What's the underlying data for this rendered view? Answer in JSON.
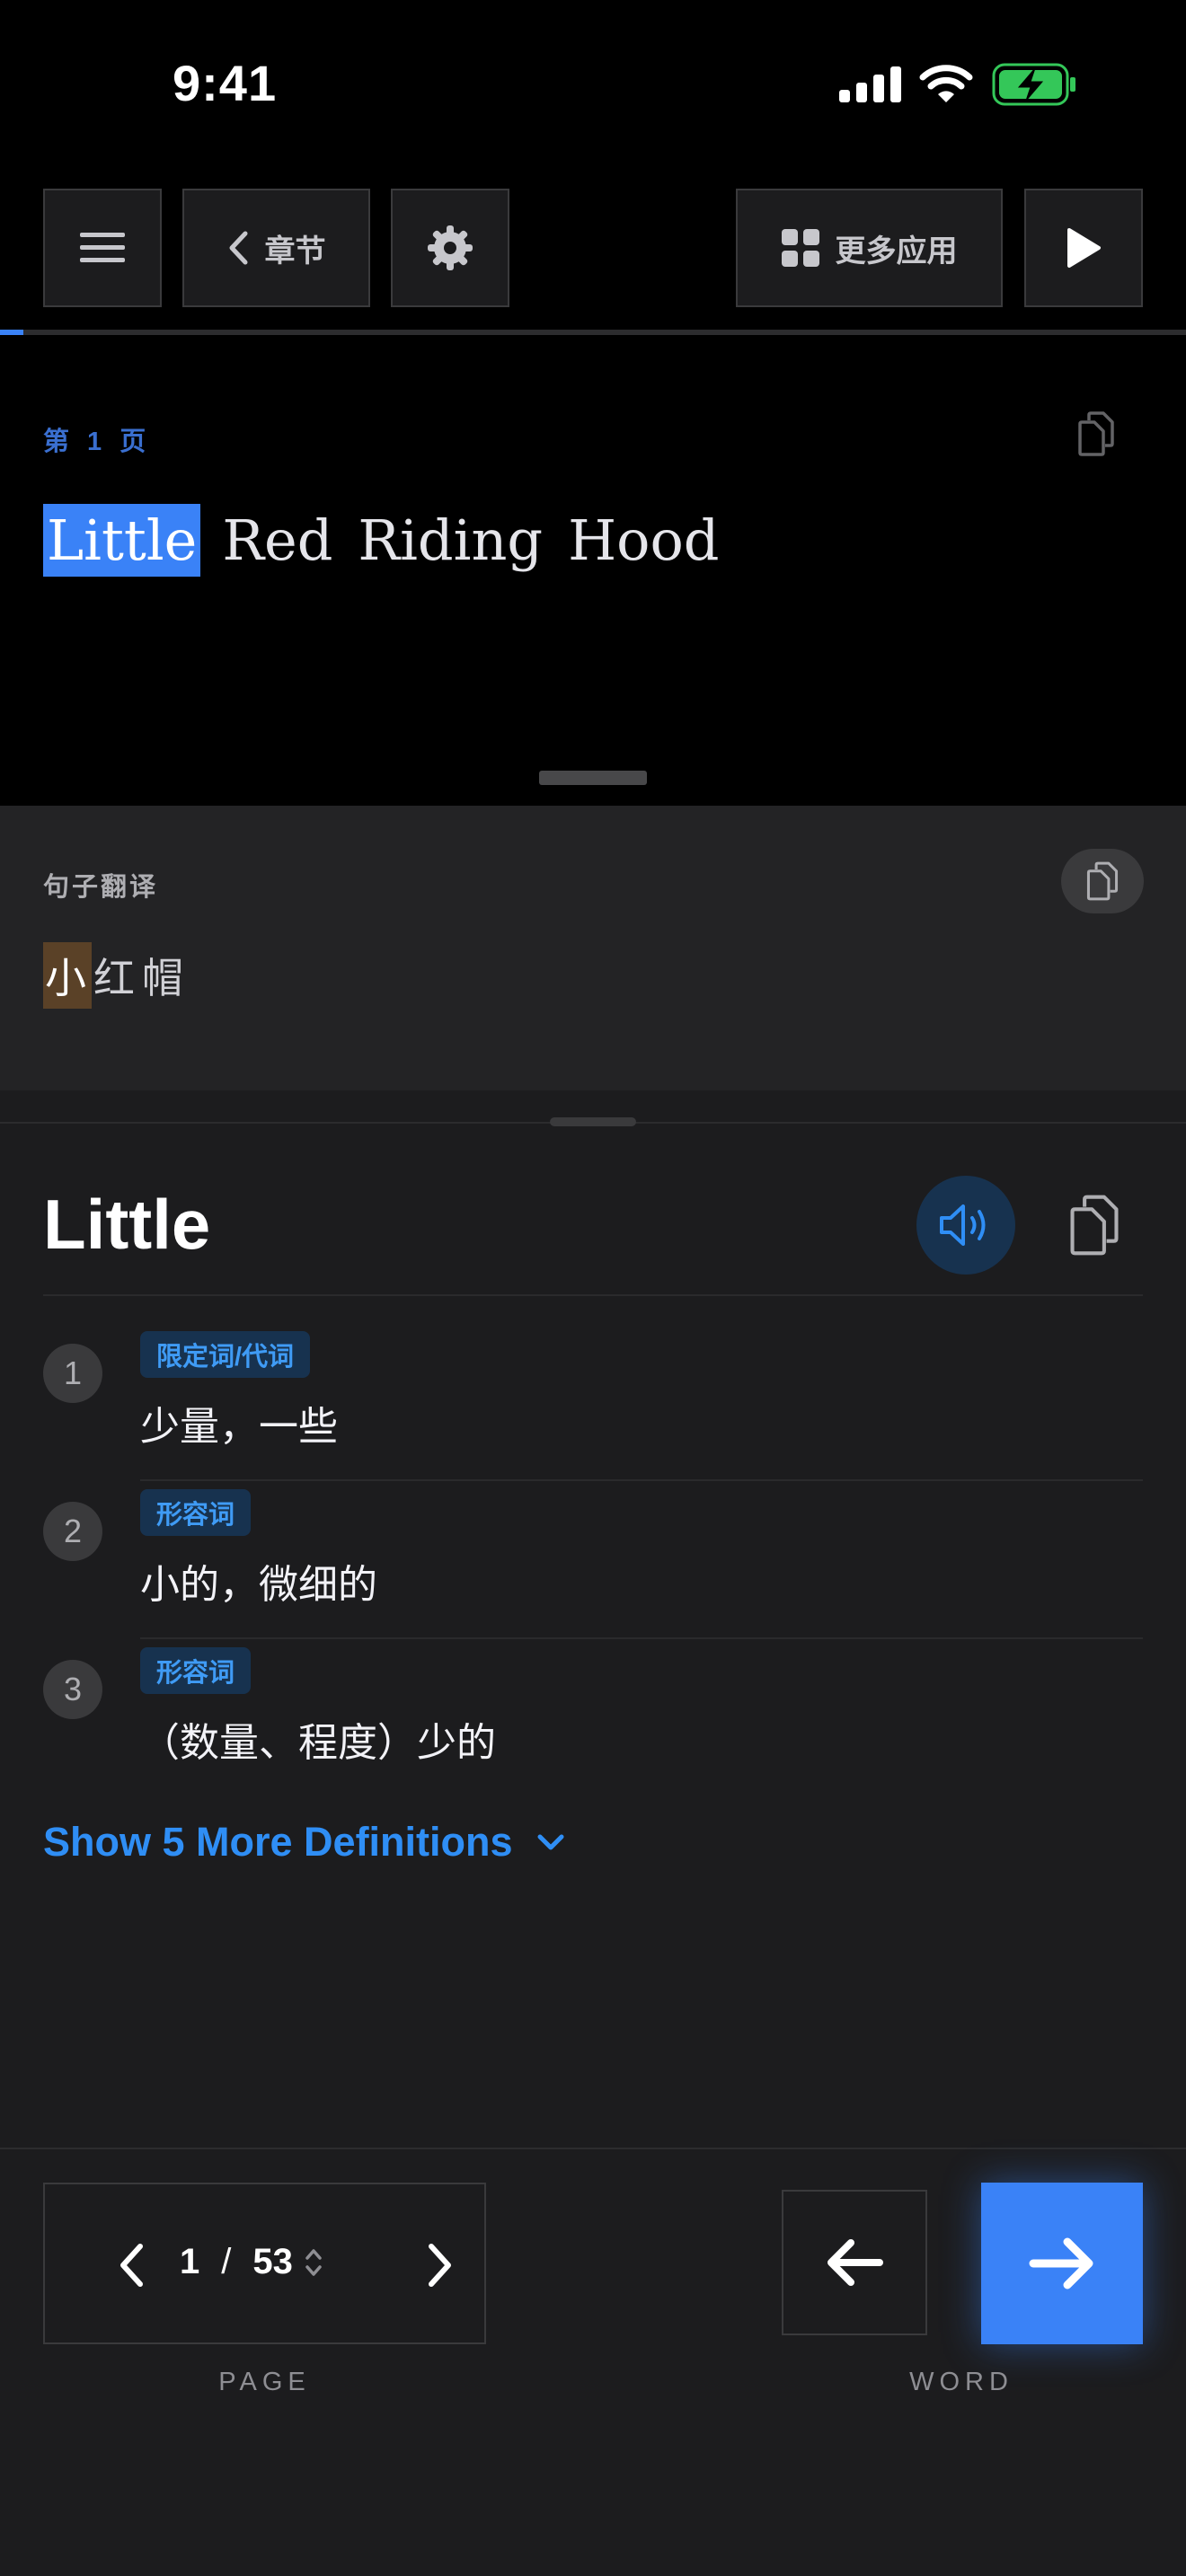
{
  "status_bar": {
    "time": "9:41"
  },
  "toolbar": {
    "chapters_label": "章节",
    "more_apps_label": "更多应用"
  },
  "reader": {
    "page_label": "第 1 页",
    "progress": 0.02,
    "sentence": [
      {
        "text": "Little",
        "highlighted": true
      },
      {
        "text": "Red",
        "highlighted": false
      },
      {
        "text": "Riding",
        "highlighted": false
      },
      {
        "text": "Hood",
        "highlighted": false
      }
    ]
  },
  "translation": {
    "title": "句子翻译",
    "chars": [
      "小",
      "红",
      "帽"
    ]
  },
  "dictionary": {
    "word": "Little",
    "definitions": [
      {
        "num": "1",
        "pos": "限定词/代词",
        "text": "少量，一些"
      },
      {
        "num": "2",
        "pos": "形容词",
        "text": "小的，微细的"
      },
      {
        "num": "3",
        "pos": "形容词",
        "text": "（数量、程度）少的"
      }
    ],
    "more_label": "Show 5 More Definitions"
  },
  "pager": {
    "current": "1",
    "separator": "/",
    "total": "53",
    "page_label": "PAGE",
    "word_label": "WORD"
  },
  "colors": {
    "accent": "#3a82f7",
    "link": "#2f8ef5",
    "tag_bg": "#17324f",
    "translation_highlight": "#5a4127",
    "battery": "#34c759"
  }
}
